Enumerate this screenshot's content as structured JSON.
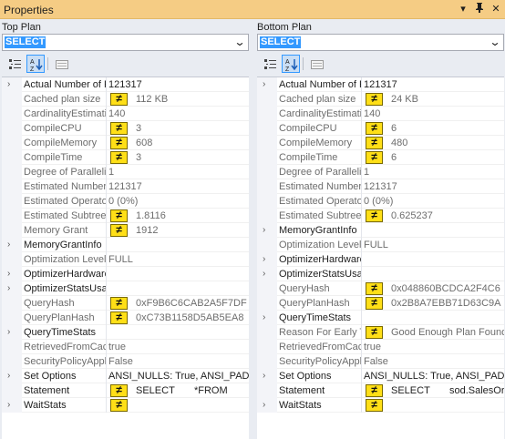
{
  "window": {
    "title": "Properties",
    "buttons": {
      "menu": "▾",
      "pin": "📌",
      "close": "✕"
    }
  },
  "panes": [
    {
      "label": "Top Plan",
      "selected": "SELECT",
      "rows": [
        {
          "name": "Actual Number of R",
          "value": "121317",
          "cat": true,
          "expand": true,
          "icon": false
        },
        {
          "name": "Cached plan size",
          "value": "112 KB",
          "cat": false,
          "expand": false,
          "icon": true
        },
        {
          "name": "CardinalityEstimatio",
          "value": "140",
          "cat": false,
          "expand": false,
          "icon": false
        },
        {
          "name": "CompileCPU",
          "value": "3",
          "cat": false,
          "expand": false,
          "icon": true
        },
        {
          "name": "CompileMemory",
          "value": "608",
          "cat": false,
          "expand": false,
          "icon": true
        },
        {
          "name": "CompileTime",
          "value": "3",
          "cat": false,
          "expand": false,
          "icon": true
        },
        {
          "name": "Degree of Parallelis",
          "value": "1",
          "cat": false,
          "expand": false,
          "icon": false
        },
        {
          "name": "Estimated Number",
          "value": "121317",
          "cat": false,
          "expand": false,
          "icon": false
        },
        {
          "name": "Estimated Operator",
          "value": "0 (0%)",
          "cat": false,
          "expand": false,
          "icon": false
        },
        {
          "name": "Estimated Subtree",
          "value": "1.8116",
          "cat": false,
          "expand": false,
          "icon": true
        },
        {
          "name": "Memory Grant",
          "value": "1912",
          "cat": false,
          "expand": false,
          "icon": true
        },
        {
          "name": "MemoryGrantInfo",
          "value": "",
          "cat": true,
          "expand": true,
          "icon": false
        },
        {
          "name": "Optimization Level",
          "value": "FULL",
          "cat": false,
          "expand": false,
          "icon": false
        },
        {
          "name": "OptimizerHardware",
          "value": "",
          "cat": true,
          "expand": true,
          "icon": false
        },
        {
          "name": "OptimizerStatsUsag",
          "value": "",
          "cat": true,
          "expand": true,
          "icon": false
        },
        {
          "name": "QueryHash",
          "value": "0xF9B6C6CAB2A5F7DF",
          "cat": false,
          "expand": false,
          "icon": true
        },
        {
          "name": "QueryPlanHash",
          "value": "0xC73B1158D5AB5EA8",
          "cat": false,
          "expand": false,
          "icon": true
        },
        {
          "name": "QueryTimeStats",
          "value": "",
          "cat": true,
          "expand": true,
          "icon": false
        },
        {
          "name": "RetrievedFromCach",
          "value": "true",
          "cat": false,
          "expand": false,
          "icon": false
        },
        {
          "name": "SecurityPolicyAppli",
          "value": "False",
          "cat": false,
          "expand": false,
          "icon": false
        },
        {
          "name": "Set Options",
          "value": "ANSI_NULLS: True, ANSI_PADDING",
          "cat": true,
          "expand": true,
          "icon": false
        },
        {
          "name": "Statement",
          "value": "SELECT       *FROM",
          "cat": true,
          "expand": false,
          "icon": true
        },
        {
          "name": "WaitStats",
          "value": "",
          "cat": true,
          "expand": true,
          "icon": true
        }
      ]
    },
    {
      "label": "Bottom Plan",
      "selected": "SELECT",
      "rows": [
        {
          "name": "Actual Number of R",
          "value": "121317",
          "cat": true,
          "expand": true,
          "icon": false
        },
        {
          "name": "Cached plan size",
          "value": "24 KB",
          "cat": false,
          "expand": false,
          "icon": true
        },
        {
          "name": "CardinalityEstimatio",
          "value": "140",
          "cat": false,
          "expand": false,
          "icon": false
        },
        {
          "name": "CompileCPU",
          "value": "6",
          "cat": false,
          "expand": false,
          "icon": true
        },
        {
          "name": "CompileMemory",
          "value": "480",
          "cat": false,
          "expand": false,
          "icon": true
        },
        {
          "name": "CompileTime",
          "value": "6",
          "cat": false,
          "expand": false,
          "icon": true
        },
        {
          "name": "Degree of Parallelis",
          "value": "1",
          "cat": false,
          "expand": false,
          "icon": false
        },
        {
          "name": "Estimated Number",
          "value": "121317",
          "cat": false,
          "expand": false,
          "icon": false
        },
        {
          "name": "Estimated Operato",
          "value": "0 (0%)",
          "cat": false,
          "expand": false,
          "icon": false
        },
        {
          "name": "Estimated Subtree",
          "value": "0.625237",
          "cat": false,
          "expand": false,
          "icon": true
        },
        {
          "name": "MemoryGrantInfo",
          "value": "",
          "cat": true,
          "expand": true,
          "icon": false
        },
        {
          "name": "Optimization Level",
          "value": "FULL",
          "cat": false,
          "expand": false,
          "icon": false
        },
        {
          "name": "OptimizerHardware",
          "value": "",
          "cat": true,
          "expand": true,
          "icon": false
        },
        {
          "name": "OptimizerStatsUsag",
          "value": "",
          "cat": true,
          "expand": true,
          "icon": false
        },
        {
          "name": "QueryHash",
          "value": "0x048860BCDCA2F4C6",
          "cat": false,
          "expand": false,
          "icon": true
        },
        {
          "name": "QueryPlanHash",
          "value": "0x2B8A7EBB71D63C9A",
          "cat": false,
          "expand": false,
          "icon": true
        },
        {
          "name": "QueryTimeStats",
          "value": "",
          "cat": true,
          "expand": true,
          "icon": false
        },
        {
          "name": "Reason For Early T",
          "value": "Good Enough Plan Found",
          "cat": false,
          "expand": false,
          "icon": true
        },
        {
          "name": "RetrievedFromCac",
          "value": "true",
          "cat": false,
          "expand": false,
          "icon": false
        },
        {
          "name": "SecurityPolicyAppl",
          "value": "False",
          "cat": false,
          "expand": false,
          "icon": false
        },
        {
          "name": "Set Options",
          "value": "ANSI_NULLS: True, ANSI_PADDING",
          "cat": true,
          "expand": true,
          "icon": false
        },
        {
          "name": "Statement",
          "value": "SELECT       sod.SalesOrderID",
          "cat": true,
          "expand": false,
          "icon": true
        },
        {
          "name": "WaitStats",
          "value": "",
          "cat": true,
          "expand": true,
          "icon": true
        }
      ]
    }
  ],
  "icons": {
    "categorized": "categorized-icon",
    "alphabetical": "alphabetical-sort-icon",
    "property_pages": "property-pages-icon",
    "different_value": "not-equal-icon",
    "expander": "chevron-right-icon",
    "dropdown": "chevron-down-icon"
  },
  "colors": {
    "titlebar": "#f5cc84",
    "selection": "#3399ff",
    "diff_icon": "#ffdf17"
  }
}
